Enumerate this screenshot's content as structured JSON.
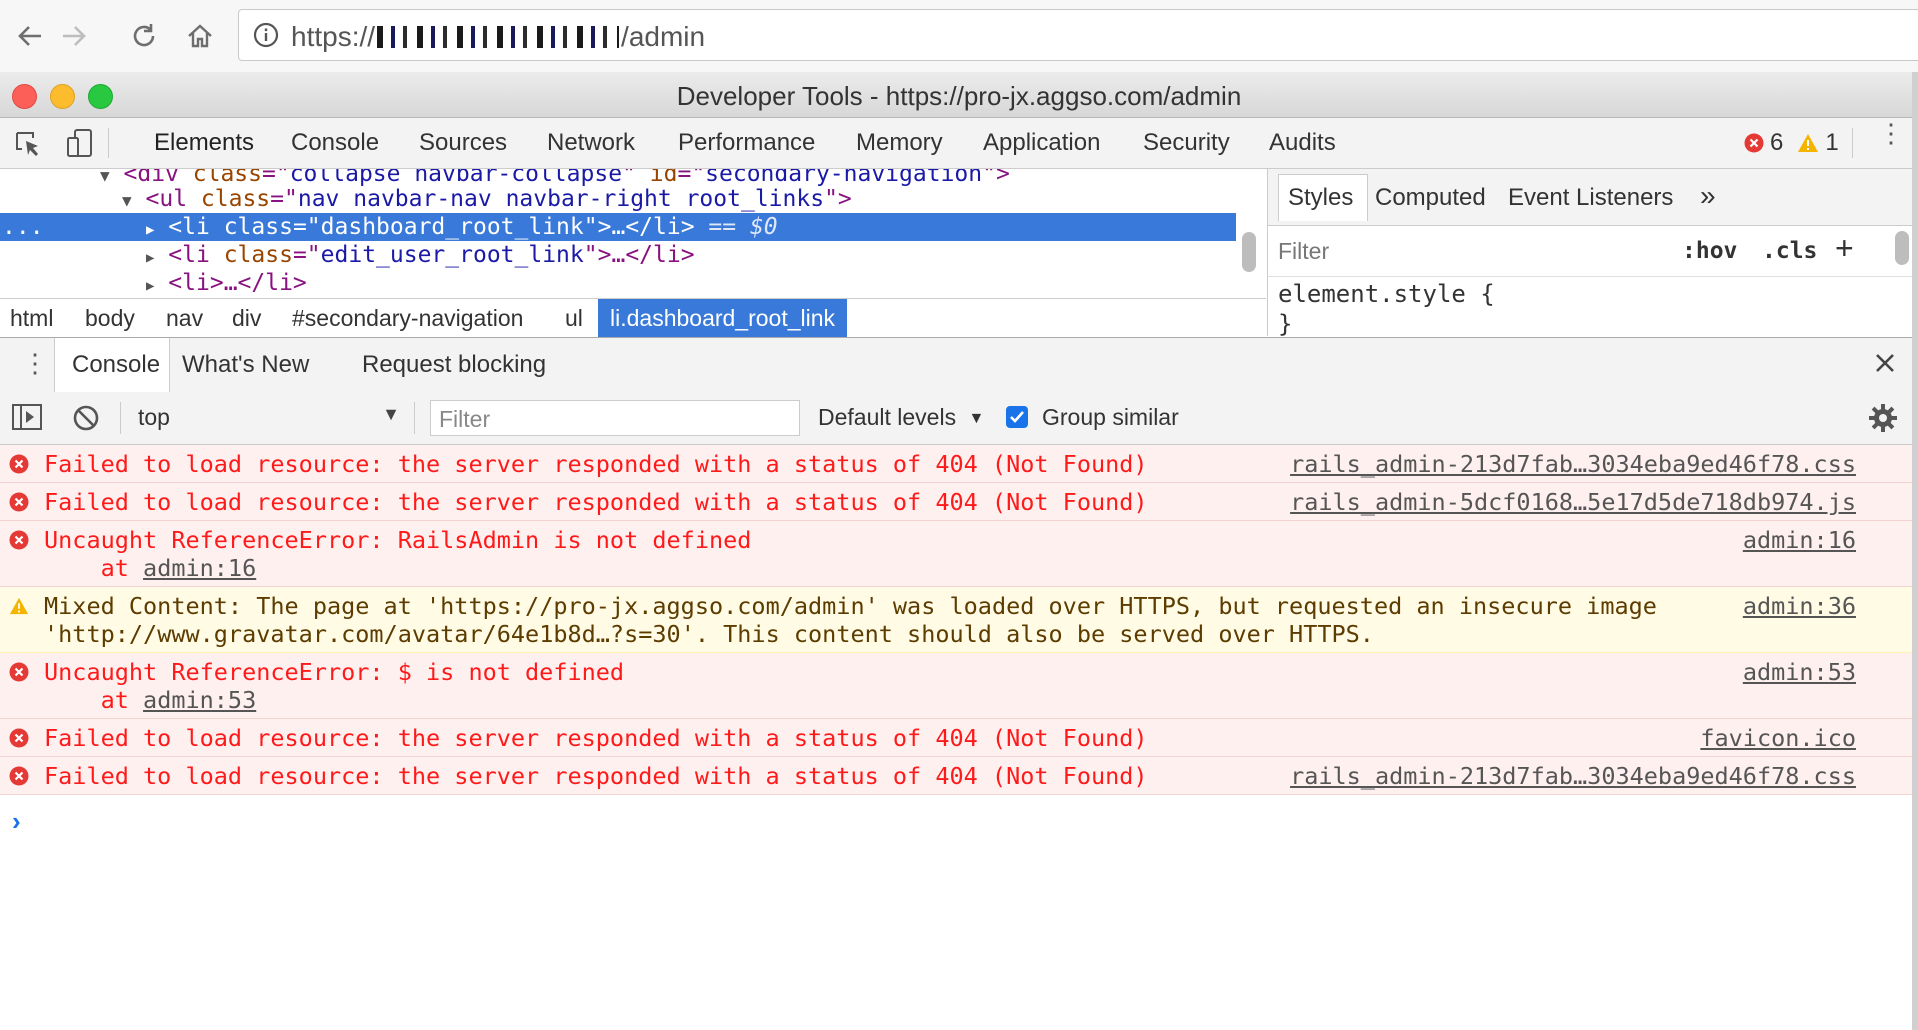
{
  "browser": {
    "url_prefix": "https://",
    "url_suffix": "/admin"
  },
  "window": {
    "title": "Developer Tools - https://pro-jx.aggso.com/admin"
  },
  "devtools": {
    "tabs": [
      "Elements",
      "Console",
      "Sources",
      "Network",
      "Performance",
      "Memory",
      "Application",
      "Security",
      "Audits"
    ],
    "active_tab": "Elements",
    "error_count": "6",
    "warning_count": "1"
  },
  "elements": {
    "lines": [
      {
        "arrow": "▼",
        "tag_open": "<div",
        "attrs": [
          [
            "class",
            "collapse navbar-collapse"
          ],
          [
            "id",
            "secondary-navigation"
          ]
        ],
        "tail": ">"
      },
      {
        "arrow": "▼",
        "tag_open": "<ul",
        "attrs": [
          [
            "class",
            "nav navbar-nav navbar-right root_links"
          ]
        ],
        "tail": ">"
      },
      {
        "arrow": "▶",
        "tag_open": "<li",
        "attrs": [
          [
            "class",
            "dashboard_root_link"
          ]
        ],
        "tail": ">…</li>",
        "suffix": " == $0"
      },
      {
        "arrow": "▶",
        "tag_open": "<li",
        "attrs": [
          [
            "class",
            "edit_user_root_link"
          ]
        ],
        "tail": ">…</li>"
      },
      {
        "arrow": "▶",
        "tag_open": "<li>",
        "attrs": [],
        "tail": "…</li>"
      }
    ],
    "ellipsis": "...",
    "breadcrumbs": [
      "html",
      "body",
      "nav",
      "div",
      "#secondary-navigation",
      "ul",
      "li.dashboard_root_link"
    ]
  },
  "styles": {
    "tabs": [
      "Styles",
      "Computed",
      "Event Listeners"
    ],
    "more": "»",
    "filter_placeholder": "Filter",
    "hov": ":hov",
    "cls": ".cls",
    "plus": "+",
    "code_line1": "element.style {",
    "code_line2": "}"
  },
  "drawer": {
    "tabs": [
      "Console",
      "What's New",
      "Request blocking"
    ],
    "context": "top",
    "filter_placeholder": "Filter",
    "levels": "Default levels",
    "group_similar": "Group similar",
    "group_similar_checked": true
  },
  "console": {
    "messages": [
      {
        "type": "error",
        "text": "Failed to load resource: the server responded with a status of 404 (Not Found)",
        "source": "rails_admin-213d7fab…3034eba9ed46f78.css"
      },
      {
        "type": "error",
        "text": "Failed to load resource: the server responded with a status of 404 (Not Found)",
        "source": "rails_admin-5dcf0168…5e17d5de718db974.js"
      },
      {
        "type": "error",
        "text": "Uncaught ReferenceError: RailsAdmin is not defined",
        "at_prefix": "    at ",
        "at_link": "admin:16",
        "source": "admin:16"
      },
      {
        "type": "warning",
        "text_a": "Mixed Content: The page at '",
        "link_a": "https://pro-jx.aggso.com/admin",
        "text_b": "' was loaded over HTTPS, but requested an insecure image",
        "text_c": "'",
        "link_b": "http://www.gravatar.com/avatar/64e1b8d…?s=30",
        "text_d": "'. This content should also be served over HTTPS.",
        "source": "admin:36"
      },
      {
        "type": "error",
        "text": "Uncaught ReferenceError: $ is not defined",
        "at_prefix": "    at ",
        "at_link": "admin:53",
        "source": "admin:53"
      },
      {
        "type": "error",
        "text": "Failed to load resource: the server responded with a status of 404 (Not Found)",
        "source": "favicon.ico"
      },
      {
        "type": "error",
        "text": "Failed to load resource: the server responded with a status of 404 (Not Found)",
        "source": "rails_admin-213d7fab…3034eba9ed46f78.css"
      }
    ],
    "prompt": "›"
  },
  "colors": {
    "error": "#ff1a1a",
    "selection": "#3879d9",
    "warning_icon": "#f4b400"
  }
}
